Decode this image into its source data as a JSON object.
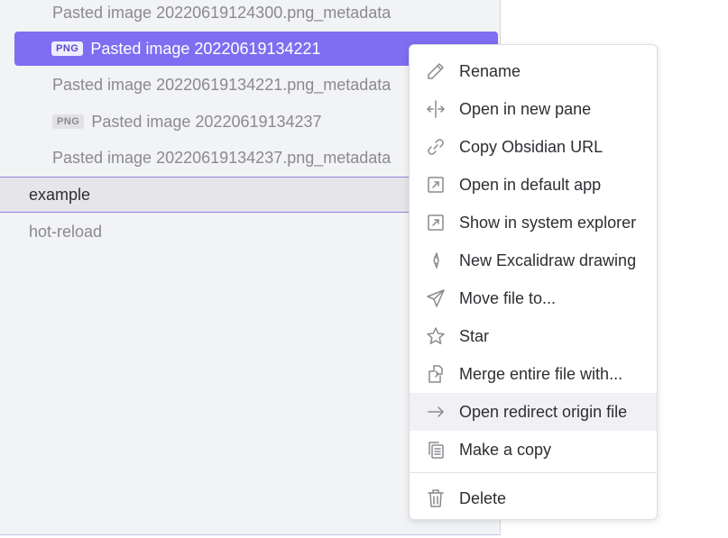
{
  "explorer": {
    "items": [
      {
        "label": "Pasted image 20220619124300.png_metadata"
      },
      {
        "badge": "PNG",
        "label": "Pasted image 20220619134221"
      },
      {
        "label": "Pasted image 20220619134221.png_metadata"
      },
      {
        "badge": "PNG",
        "label": "Pasted image 20220619134237"
      },
      {
        "label": "Pasted image 20220619134237.png_metadata"
      },
      {
        "label": "example"
      },
      {
        "label": "hot-reload"
      }
    ]
  },
  "context_menu": {
    "items": [
      {
        "label": "Rename",
        "icon": "pencil-icon"
      },
      {
        "label": "Open in new pane",
        "icon": "split-pane-icon"
      },
      {
        "label": "Copy Obsidian URL",
        "icon": "link-icon"
      },
      {
        "label": "Open in default app",
        "icon": "external-link-icon"
      },
      {
        "label": "Show in system explorer",
        "icon": "external-link-icon"
      },
      {
        "label": "New Excalidraw drawing",
        "icon": "excalidraw-icon"
      },
      {
        "label": "Move file to...",
        "icon": "paper-plane-icon"
      },
      {
        "label": "Star",
        "icon": "star-icon"
      },
      {
        "label": "Merge entire file with...",
        "icon": "merge-icon"
      },
      {
        "label": "Open redirect origin file",
        "icon": "arrow-right-icon"
      },
      {
        "label": "Make a copy",
        "icon": "copy-icon"
      },
      {
        "label": "Delete",
        "icon": "trash-icon"
      }
    ],
    "hovered_item": "Open redirect origin file"
  },
  "colors": {
    "accent": "#7f6df2",
    "explorer_bg": "#f2f3f5",
    "text_muted": "#8a8a8f",
    "text_normal": "#2e2e33"
  }
}
